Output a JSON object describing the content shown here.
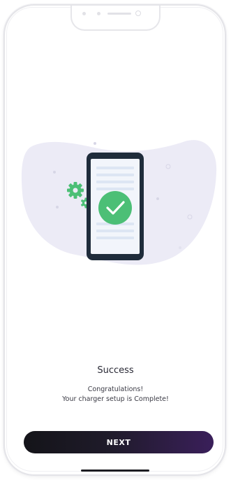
{
  "status": {
    "title": "Success",
    "message_line1": "Congratulations!",
    "message_line2": "Your charger setup is Complete!"
  },
  "actions": {
    "next_label": "NEXT"
  },
  "icons": {
    "illustration": "phone-success-icon",
    "check": "check-icon",
    "gear": "gear-icon"
  },
  "colors": {
    "blob": "#ecebf6",
    "phone_body": "#1f2c3b",
    "success_green": "#4cbf76",
    "gear_green": "#4cbf76",
    "button_start": "#141419",
    "button_end": "#3a1f5a"
  }
}
